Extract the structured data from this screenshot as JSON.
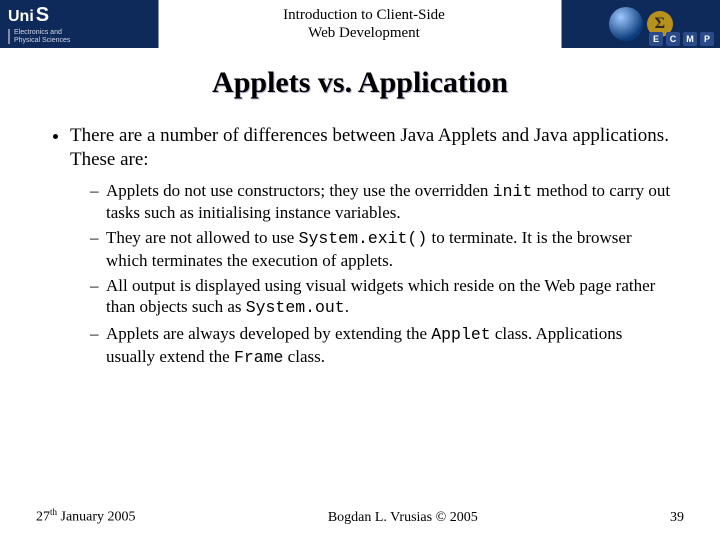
{
  "header": {
    "logo_prefix": "Uni",
    "logo_suffix": "S",
    "department_line1": "Electronics and",
    "department_line2": "Physical Sciences",
    "course_line1": "Introduction to Client-Side",
    "course_line2": "Web Development",
    "sigma": "Σ",
    "ecmp": [
      "E",
      "C",
      "M",
      "P"
    ]
  },
  "title": "Applets vs. Application",
  "bullets": {
    "intro": "There are a number of differences between Java Applets and Java applications. These are:",
    "sub": [
      {
        "pre": "Applets do not use constructors; they use the overridden ",
        "code": "init",
        "post": " method to carry out tasks such as initialising instance variables."
      },
      {
        "pre": "They are not allowed to use ",
        "code": "System.exit()",
        "post": " to terminate. It is the browser which terminates the execution of applets."
      },
      {
        "pre": "All output is displayed using visual widgets which reside on the Web page rather than objects such as ",
        "code": "System.out",
        "post": "."
      },
      {
        "pre": "Applets are always developed by extending the ",
        "code": "Applet",
        "mid": " class. Applications usually extend the ",
        "code2": "Frame",
        "post": " class."
      }
    ]
  },
  "footer": {
    "date_day": "27",
    "date_suffix": "th",
    "date_rest": " January 2005",
    "author": "Bogdan L. Vrusias © 2005",
    "page": "39"
  }
}
